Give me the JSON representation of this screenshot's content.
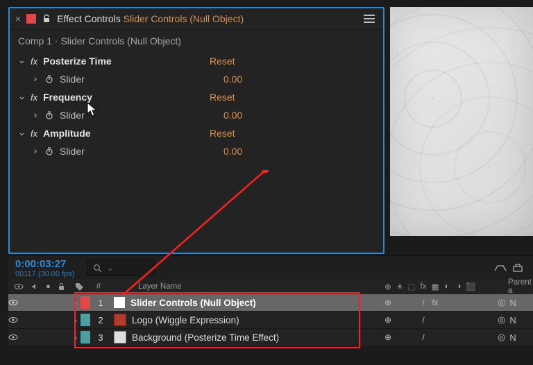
{
  "panel": {
    "title_prefix": "Effect Controls",
    "title_suffix": "Slider Controls (Null Object)",
    "comp_path": "Comp 1 · Slider Controls (Null Object)"
  },
  "effects": [
    {
      "name": "Posterize Time",
      "reset": "Reset",
      "prop": {
        "label": "Slider",
        "value": "0.00"
      }
    },
    {
      "name": "Frequency",
      "reset": "Reset",
      "prop": {
        "label": "Slider",
        "value": "0.00"
      }
    },
    {
      "name": "Amplitude",
      "reset": "Reset",
      "prop": {
        "label": "Slider",
        "value": "0.00"
      }
    }
  ],
  "timeline": {
    "timecode": "0:00:03:27",
    "frameinfo": "00117 (30.00 fps)",
    "search_placeholder": ""
  },
  "columns": {
    "num": "#",
    "layer_name": "Layer Name",
    "switches": [
      "⊕",
      "☀",
      "⬚",
      "fx",
      "▦",
      "◐",
      "◑",
      "⬛"
    ],
    "parent": "Parent a"
  },
  "layers": [
    {
      "num": "1",
      "color": "#e44747",
      "icon_bg": "#ffffff",
      "name": "Slider Controls (Null Object)",
      "selected": true,
      "switches": [
        "⊕",
        "",
        "",
        "/",
        "fx",
        "",
        "",
        ""
      ],
      "parent": "N"
    },
    {
      "num": "2",
      "color": "#4aa0a0",
      "icon_bg": "#b43a2c",
      "name": "Logo (Wiggle Expression)",
      "selected": false,
      "switches": [
        "⊕",
        "",
        "",
        "/",
        "",
        "",
        "",
        ""
      ],
      "parent": "N"
    },
    {
      "num": "3",
      "color": "#4aa0a0",
      "icon_bg": "#dddddd",
      "name": "Background (Posterize Time Effect)",
      "selected": false,
      "switches": [
        "⊕",
        "",
        "",
        "/",
        "",
        "",
        "",
        ""
      ],
      "parent": "N"
    }
  ],
  "icons": {
    "eye": "◉",
    "tag": "🏷",
    "search": "⌕"
  }
}
